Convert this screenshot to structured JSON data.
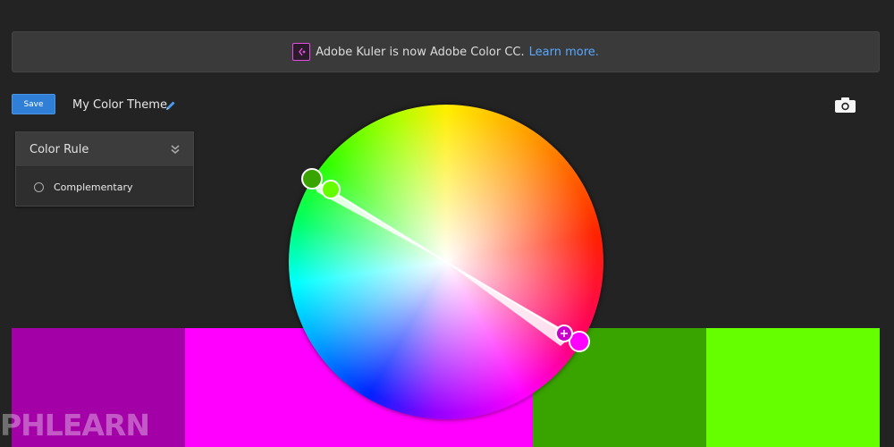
{
  "banner": {
    "icon": "kuler-logo-icon",
    "message": "Adobe Kuler is now Adobe Color CC.",
    "link": "Learn more."
  },
  "toolbar": {
    "save_label": "Save",
    "theme_name": "My Color Theme",
    "edit_icon": "pencil-icon",
    "camera_icon": "camera-icon"
  },
  "color_rule": {
    "title": "Color Rule",
    "toggle_icon": "double-chevron-down-icon",
    "selected_rule": "Complementary"
  },
  "swatches": [
    {
      "color": "#a300a8"
    },
    {
      "color": "#ff00ff"
    },
    {
      "color": "#39a300"
    },
    {
      "color": "#66ff00"
    }
  ],
  "colors": {
    "accent": "#2f7fd6",
    "link": "#58a8ff",
    "background": "#232323"
  },
  "watermark": "PHLEARN"
}
